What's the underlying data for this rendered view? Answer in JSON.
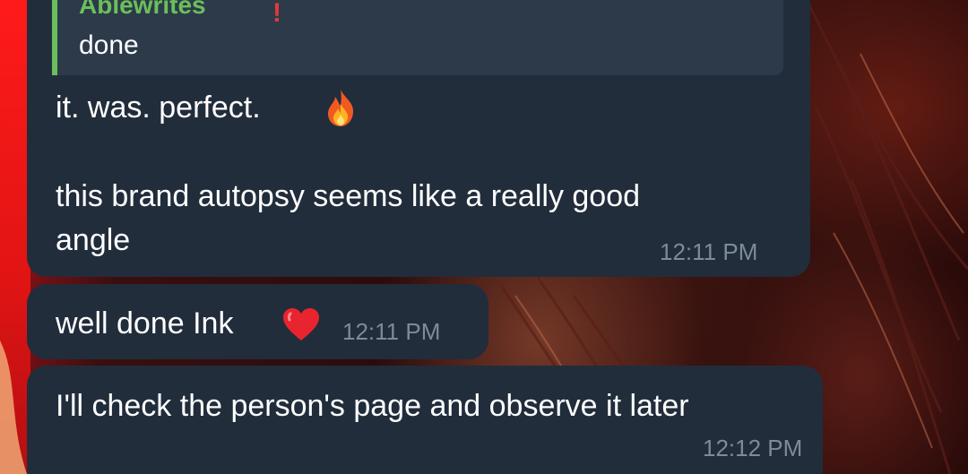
{
  "messages": [
    {
      "reply": {
        "author": "Ablewrites",
        "author_mark": "!",
        "text": "done"
      },
      "lines": [
        "it. was. perfect.",
        "this brand autopsy seems like a really good",
        "angle"
      ],
      "time": "12:11 PM",
      "emoji": "fire-emoji"
    },
    {
      "text": "well done Ink",
      "time": "12:11 PM",
      "emoji": "red-heart-emoji"
    },
    {
      "text": "I'll check the person's page and observe it later",
      "time": "12:12 PM"
    }
  ],
  "colors": {
    "bubble": "#212d3b",
    "reply_bg": "#2c3a4a",
    "reply_accent": "#6bbf5b",
    "timestamp": "#7d8b99",
    "text": "#ffffff"
  }
}
